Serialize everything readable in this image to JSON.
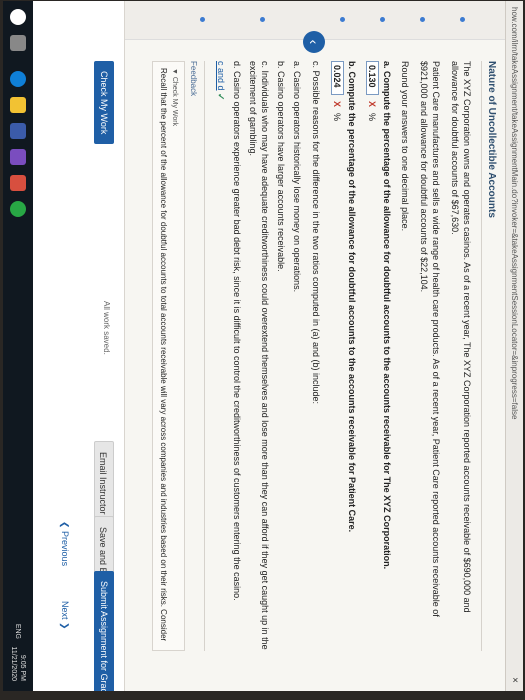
{
  "browser": {
    "url": "how.com/ilrn/takeAssignment/takeAssignmentMain.do?invoker=&takeAssignmentSessionLocator=&inprogress=false",
    "tab_close": "×"
  },
  "question": {
    "title": "Nature of Uncollectible Accounts",
    "intro": "The XYZ Corporation owns and operates casinos. As of a recent year, The XYZ Corporation reported accounts receivable of $690,000 and allowance for doubtful accounts of $67,630.",
    "intro2": "Patient Care manufactures and sells a wide range of health care products. As of a recent year, Patient Care reported accounts receivable of $921,000 and allowance for doubtful accounts of $22,104.",
    "instruction": "Round your answers to one decimal place.",
    "part_a": {
      "prompt": "a. Compute the percentage of the allowance for doubtful accounts to the accounts receivable for The XYZ Corporation.",
      "answer": "0.130",
      "mark": "X",
      "unit": "%"
    },
    "part_b": {
      "prompt": "b. Compute the percentage of the allowance for doubtful accounts to the accounts receivable for Patient Care.",
      "answer": "0.024",
      "mark": "X",
      "unit": "%"
    },
    "part_c": {
      "prompt": "c. Possible reasons for the difference in the two ratios computed in (a) and (b) include:",
      "options": [
        "a. Casino operators historically lose money on operations.",
        "b. Casino operators have larger accounts receivable.",
        "c. Individuals who may have adequate creditworthiness could overextend themselves and lose more than they can afford if they get caught up in the excitement of gambling.",
        "d. Casino operators experience greater bad debt risk, since it is difficult to control the creditworthiness of customers entering the casino."
      ],
      "answer": "c and d",
      "mark": "✓"
    }
  },
  "feedback": {
    "title": "Feedback",
    "sub": "▼ Check My Work",
    "text": "Recall that the percent of the allowance for doubtful accounts to total accounts receivable will vary across companies and industries based on their risks. Consider"
  },
  "footer": {
    "check_work": "Check My Work",
    "saved": "All work saved.",
    "email": "Email Instructor",
    "save_exit": "Save and Exit",
    "submit": "Submit Assignment for Grading",
    "previous": "Previous",
    "next": "Next"
  },
  "taskbar": {
    "lang": "ENG",
    "time": "9:05 PM",
    "date": "11/21/2020"
  },
  "colors": {
    "accent": "#1f5fa6",
    "wrong": "#c0392b",
    "correct": "#2e8b57"
  }
}
